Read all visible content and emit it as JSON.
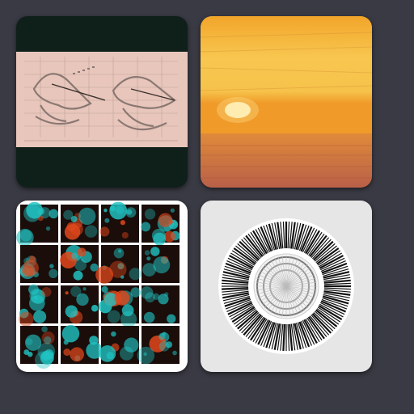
{
  "gallery": {
    "tiles": [
      {
        "name": "technical-drawing-thumbnail",
        "bg": "#0f1f1a",
        "panel": "#e8c6bb"
      },
      {
        "name": "sunset-ocean-thumbnail",
        "sky_top": "#f6b02a",
        "sky_mid": "#f8d05a",
        "sea": "#c0624a"
      },
      {
        "name": "bubble-grid-thumbnail",
        "frame": "#ffffff",
        "cell_bg": "#1a0d0a",
        "accent1": "#21c3c3",
        "accent2": "#e0471c"
      },
      {
        "name": "radial-mandala-thumbnail",
        "bg": "#e6e6e6",
        "ink": "#111111"
      }
    ]
  }
}
